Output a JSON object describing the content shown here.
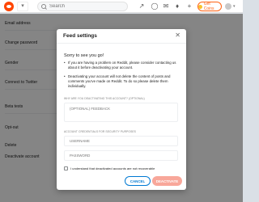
{
  "topbar": {
    "search_placeholder": "Search",
    "get_coins_label": "Get Coins",
    "icons": [
      "reddit-logo",
      "community-dropdown",
      "search-icon",
      "trending-icon",
      "popular-icon",
      "chat-icon",
      "notification-bell-icon",
      "add-post-icon",
      "coins-icon",
      "avatar"
    ]
  },
  "background": {
    "labels": [
      "Email address",
      "Change password",
      "Gender",
      "Connect to Twitter",
      "Beta tests",
      "Opt-out",
      "Delete",
      "Deactivate account"
    ]
  },
  "modal": {
    "title": "Feed settings",
    "sorry": "Sorry to see you go!",
    "bullets": [
      "If you are having a problem on Reddit, please consider contacting us about it before deactivating your account.",
      "Deactivating your account will not delete the content of posts and comments you've made on Reddit. To do so please delete them individually."
    ],
    "feedback_label": "Why are you deactivating this account? (optional)",
    "feedback_placeholder": "(OPTIONAL) FEEDBACK",
    "credentials_label": "Account credentials for security purposes",
    "username_placeholder": "USERNAME",
    "password_placeholder": "PASSWORD",
    "checkbox_label": "I understand that deactivated accounts are not recoverable",
    "cancel_label": "CANCEL",
    "deactivate_label": "DEACTIVATE"
  },
  "colors": {
    "brand": "#ff4500",
    "link_blue": "#0079d3",
    "deactivate_disabled": "#f8a79a",
    "overlay": "rgba(0,0,0,0.48)"
  }
}
